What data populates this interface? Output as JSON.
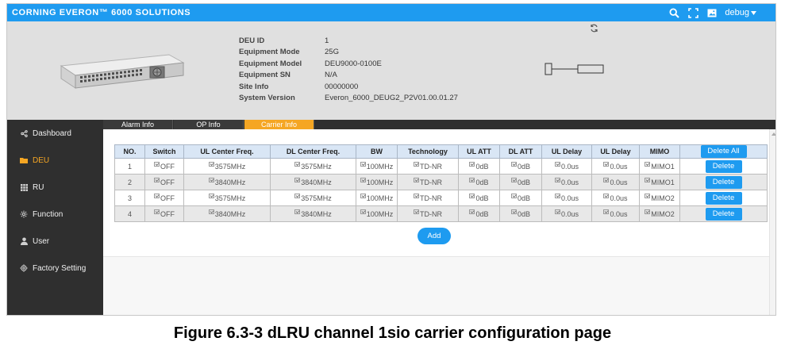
{
  "app": {
    "title": "CORNING EVERON™ 6000 SOLUTIONS"
  },
  "topbar": {
    "icons": [
      "search-icon",
      "fullscreen-icon",
      "image-icon"
    ],
    "user": "debug"
  },
  "deu_info": {
    "rows": [
      {
        "label": "DEU ID",
        "value": "1"
      },
      {
        "label": "Equipment Mode",
        "value": "25G"
      },
      {
        "label": "Equipment Model",
        "value": "DEU9000-0100E"
      },
      {
        "label": "Equipment SN",
        "value": "N/A"
      },
      {
        "label": "Site Info",
        "value": "00000000"
      },
      {
        "label": "System Version",
        "value": "Everon_6000_DEUG2_P2V01.00.01.27"
      }
    ]
  },
  "sidebar": {
    "items": [
      {
        "label": "Dashboard",
        "icon": "share-icon",
        "active": false
      },
      {
        "label": "DEU",
        "icon": "folder-icon",
        "active": true
      },
      {
        "label": "RU",
        "icon": "grid-icon",
        "active": false
      },
      {
        "label": "Function",
        "icon": "gear-icon",
        "active": false
      },
      {
        "label": "User",
        "icon": "user-icon",
        "active": false
      },
      {
        "label": "Factory Setting",
        "icon": "cog-icon",
        "active": false
      }
    ]
  },
  "tabs": [
    {
      "label": "Alarm Info",
      "active": false
    },
    {
      "label": "OP Info",
      "active": false
    },
    {
      "label": "Carrier Info",
      "active": true
    }
  ],
  "table": {
    "headers": [
      "NO.",
      "Switch",
      "UL Center Freq.",
      "DL Center Freq.",
      "BW",
      "Technology",
      "UL ATT",
      "DL ATT",
      "UL Delay",
      "UL Delay",
      "MIMO"
    ],
    "delete_all_label": "Delete All",
    "delete_label": "Delete",
    "rows": [
      [
        "1",
        "OFF",
        "3575MHz",
        "3575MHz",
        "100MHz",
        "TD-NR",
        "0dB",
        "0dB",
        "0.0us",
        "0.0us",
        "MIMO1"
      ],
      [
        "2",
        "OFF",
        "3840MHz",
        "3840MHz",
        "100MHz",
        "TD-NR",
        "0dB",
        "0dB",
        "0.0us",
        "0.0us",
        "MIMO1"
      ],
      [
        "3",
        "OFF",
        "3575MHz",
        "3575MHz",
        "100MHz",
        "TD-NR",
        "0dB",
        "0dB",
        "0.0us",
        "0.0us",
        "MIMO2"
      ],
      [
        "4",
        "OFF",
        "3840MHz",
        "3840MHz",
        "100MHz",
        "TD-NR",
        "0dB",
        "0dB",
        "0.0us",
        "0.0us",
        "MIMO2"
      ]
    ]
  },
  "add_label": "Add",
  "caption": "Figure 6.3-3 dLRU channel 1sio carrier configuration page",
  "colors": {
    "accent": "#1e9bf0",
    "active": "#f5a623",
    "sidebar": "#2f2f2f"
  }
}
